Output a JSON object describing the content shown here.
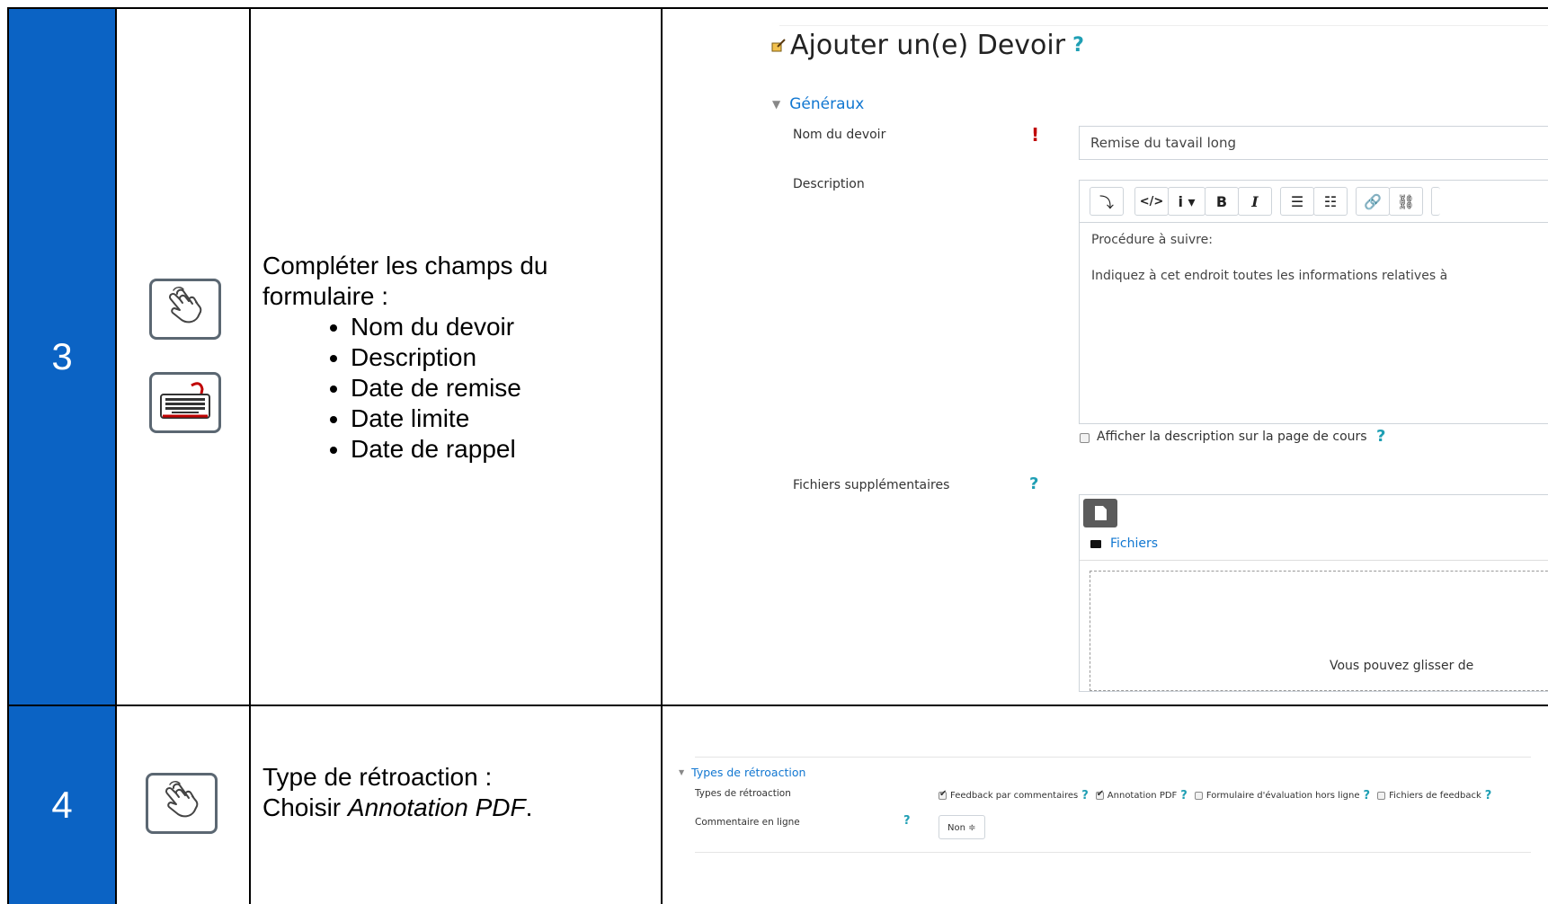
{
  "rows": [
    {
      "step": "3",
      "instruction_title": "Compléter les champs du formulaire :",
      "bullets": [
        "Nom du devoir",
        "Description",
        "Date de remise",
        "Date limite",
        "Date de rappel"
      ],
      "icons": [
        "hand-click-icon",
        "keyboard-icon"
      ]
    },
    {
      "step": "4",
      "instruction_line1": "Type de rétroaction :",
      "instruction_line2_prefix": "Choisir ",
      "instruction_line2_em": "Annotation PDF",
      "instruction_line2_suffix": ".",
      "icons": [
        "hand-click-icon"
      ]
    }
  ],
  "form": {
    "page_title": "Ajouter un(e) Devoir",
    "help": "?",
    "section": "Généraux",
    "name_label": "Nom du devoir",
    "required_mark": "!",
    "name_value": "Remise du tavail long",
    "description_label": "Description",
    "editor_buttons": [
      "⤵",
      "</>",
      "i ▾",
      "B",
      "I",
      "☰",
      "☷",
      "🔗",
      "⛓"
    ],
    "editor_line1": "Procédure à suivre:",
    "editor_line2": "Indiquez à cet endroit toutes les informations relatives à",
    "show_description_label": "Afficher la description sur la page de cours",
    "files_label": "Fichiers supplémentaires",
    "files_folder": "Fichiers",
    "dropzone_text": "Vous pouvez glisser de"
  },
  "feedback": {
    "section": "Types de rétroaction",
    "types_label": "Types de rétroaction",
    "options": [
      {
        "label": "Feedback par commentaires",
        "checked": true
      },
      {
        "label": "Annotation PDF",
        "checked": true
      },
      {
        "label": "Formulaire d'évaluation hors ligne",
        "checked": false
      },
      {
        "label": "Fichiers de feedback",
        "checked": false
      }
    ],
    "inline_label": "Commentaire en ligne",
    "inline_value": "Non ≑"
  },
  "colors": {
    "step_bg": "#0b63c4",
    "link_blue": "#1177d1",
    "help": "#1f9fb4",
    "required": "#c00000"
  }
}
